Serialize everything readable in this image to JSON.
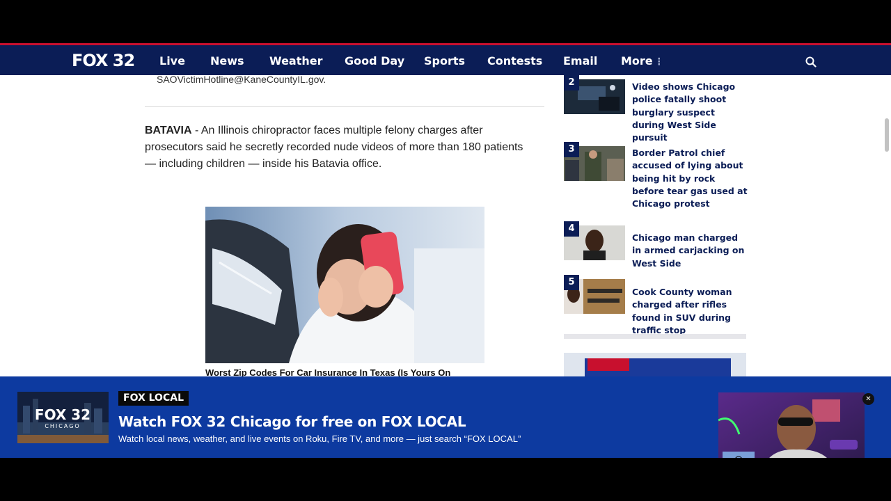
{
  "nav": {
    "logo": "FOX 32",
    "items": [
      "Live",
      "News",
      "Weather",
      "Good Day",
      "Sports",
      "Contests",
      "Email",
      "More"
    ],
    "more_dots": "⋮"
  },
  "article": {
    "email": "SAOVictimHotline@KaneCountyIL.gov.",
    "dateline": "BATAVIA",
    "body": " - An Illinois chiropractor faces multiple felony charges after prosecutors said he secretly recorded nude videos of more than 180 patients — including children — inside his Batavia office.",
    "ad_caption": "Worst Zip Codes For Car Insurance In Texas (Is Yours On"
  },
  "sidebar": {
    "items": [
      {
        "rank": "2",
        "headline": "Video shows Chicago police fatally shoot burglary suspect during West Side pursuit"
      },
      {
        "rank": "3",
        "headline": "Border Patrol chief accused of lying about being hit by rock before tear gas used at Chicago protest"
      },
      {
        "rank": "4",
        "headline": "Chicago man charged in armed carjacking on West Side"
      },
      {
        "rank": "5",
        "headline": "Cook County woman charged after rifles found in SUV during traffic stop"
      }
    ]
  },
  "banner": {
    "badge": "FOX LOCAL",
    "title": "Watch FOX 32 Chicago for free on FOX LOCAL",
    "subtitle": "Watch local news, weather, and live events on Roku, Fire TV, and more — just search “FOX LOCAL”",
    "thumb_logo": "FOX 32",
    "thumb_city": "CHICAGO"
  },
  "pip": {
    "emoji": "😎",
    "close": "✕"
  },
  "colors": {
    "nav_bg": "#0b1d56",
    "accent_red": "#c8102e",
    "banner_bg": "#0d3aa0",
    "headline": "#0b1d56"
  }
}
